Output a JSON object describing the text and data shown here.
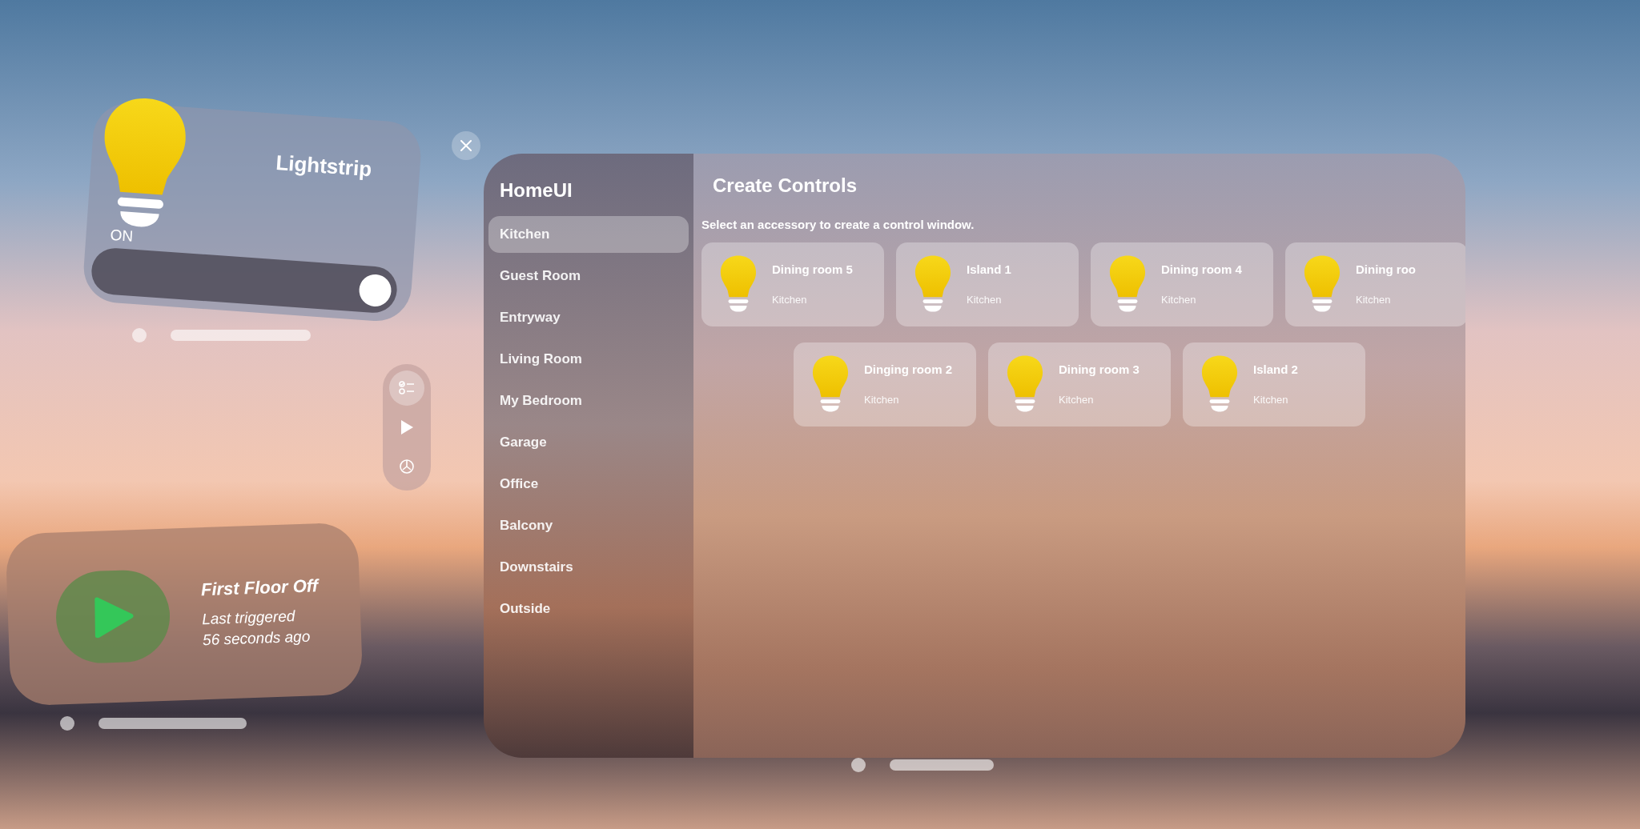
{
  "lightstrip": {
    "title": "Lightstrip",
    "state_label": "ON",
    "on": true,
    "level": 0.97
  },
  "ornament": {
    "items": [
      {
        "kind": "checklist",
        "selected": true
      },
      {
        "kind": "play",
        "selected": false
      },
      {
        "kind": "automation",
        "selected": false
      }
    ]
  },
  "scene": {
    "title": "First Floor Off",
    "lines": [
      "Last triggered",
      "56 seconds ago"
    ]
  },
  "main": {
    "app_title": "HomeUI",
    "sidebar": [
      {
        "label": "Kitchen",
        "selected": true
      },
      {
        "label": "Guest Room",
        "selected": false
      },
      {
        "label": "Entryway",
        "selected": false
      },
      {
        "label": "Living Room",
        "selected": false
      },
      {
        "label": "My Bedroom",
        "selected": false
      },
      {
        "label": "Garage",
        "selected": false
      },
      {
        "label": "Office",
        "selected": false
      },
      {
        "label": "Balcony",
        "selected": false
      },
      {
        "label": "Downstairs",
        "selected": false
      },
      {
        "label": "Outside",
        "selected": false
      }
    ],
    "heading": "Create Controls",
    "hint": "Select an accessory to create a control window.",
    "accessory_rows": [
      [
        {
          "name": "Dining room 5",
          "room": "Kitchen"
        },
        {
          "name": "Island 1",
          "room": "Kitchen"
        },
        {
          "name": "Dining room 4",
          "room": "Kitchen"
        },
        {
          "name": "Dining roo",
          "room": "Kitchen"
        }
      ],
      [
        {
          "name": "Dinging room 2",
          "room": "Kitchen"
        },
        {
          "name": "Dining room 3",
          "room": "Kitchen"
        },
        {
          "name": "Island 2",
          "room": "Kitchen"
        }
      ]
    ]
  }
}
